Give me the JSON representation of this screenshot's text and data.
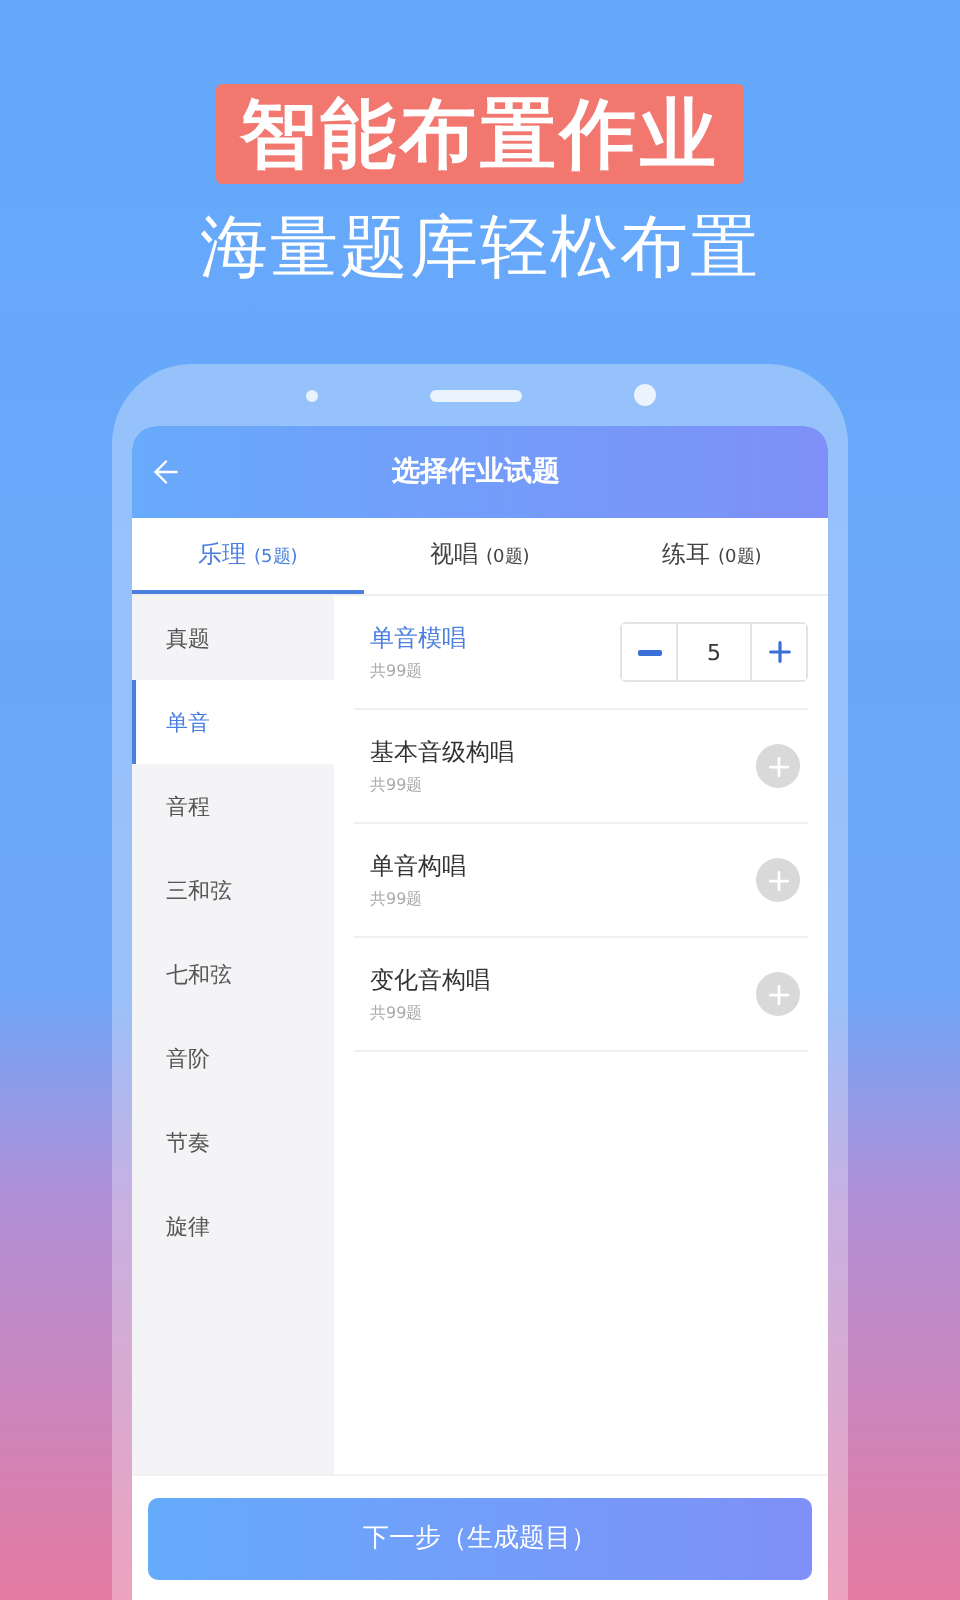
{
  "headline": "智能布置作业",
  "subtitle": "海量题库轻松布置",
  "screen": {
    "title": "选择作业试题",
    "tabs": [
      {
        "label": "乐理",
        "count": "(5题)",
        "selected": true
      },
      {
        "label": "视唱",
        "count": "(0题)",
        "selected": false
      },
      {
        "label": "练耳",
        "count": "(0题)",
        "selected": false
      }
    ],
    "categories": [
      {
        "label": "真题",
        "selected": false
      },
      {
        "label": "单音",
        "selected": true
      },
      {
        "label": "音程",
        "selected": false
      },
      {
        "label": "三和弦",
        "selected": false
      },
      {
        "label": "七和弦",
        "selected": false
      },
      {
        "label": "音阶",
        "selected": false
      },
      {
        "label": "节奏",
        "selected": false
      },
      {
        "label": "旋律",
        "selected": false
      }
    ],
    "topics": [
      {
        "name": "单音模唱",
        "count": "共99题",
        "kind": "stepper",
        "value": "5"
      },
      {
        "name": "基本音级构唱",
        "count": "共99题",
        "kind": "add"
      },
      {
        "name": "单音构唱",
        "count": "共99题",
        "kind": "add"
      },
      {
        "name": "变化音构唱",
        "count": "共99题",
        "kind": "add"
      }
    ],
    "next_button": "下一步（生成题目）"
  }
}
